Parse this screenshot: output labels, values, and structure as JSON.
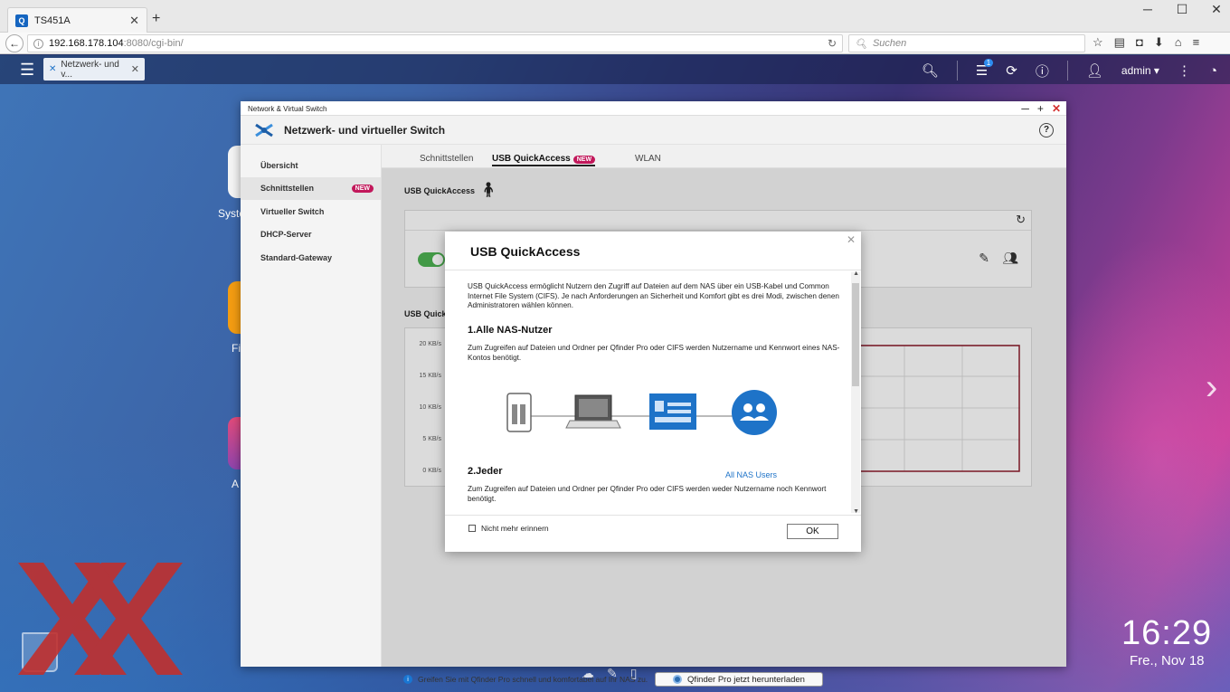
{
  "browser": {
    "tab_title": "TS451A",
    "url_host": "192.168.178.104",
    "url_path": ":8080/cgi-bin/",
    "search_placeholder": "Suchen"
  },
  "qts": {
    "task_title": "Netzwerk- und v...",
    "notification_count": "1",
    "user": "admin ▾",
    "desktop_labels": [
      "Syste",
      "Fi",
      "A"
    ],
    "clock": "16:29",
    "date": "Fre., Nov 18"
  },
  "app": {
    "window_title": "Network & Virtual Switch",
    "header_title": "Netzwerk- und virtueller Switch",
    "sidebar": [
      {
        "label": "Übersicht",
        "badge": ""
      },
      {
        "label": "Schnittstellen",
        "badge": "NEW"
      },
      {
        "label": "Virtueller Switch",
        "badge": ""
      },
      {
        "label": "DHCP-Server",
        "badge": ""
      },
      {
        "label": "Standard-Gateway",
        "badge": ""
      }
    ],
    "tabs": [
      {
        "label": "Schnittstellen",
        "badge": ""
      },
      {
        "label": "USB QuickAccess",
        "badge": "NEW"
      },
      {
        "label": "WLAN",
        "badge": ""
      }
    ],
    "section_title": "USB QuickAccess",
    "section_title_2": "USB Quick",
    "chart_ticks": [
      "20 KB/s",
      "15 KB/s",
      "10 KB/s",
      "5 KB/s",
      "0 KB/s"
    ],
    "footer_text": "Greifen Sie mit Qfinder Pro schnell und komfortabel auf Ihr NAS zu.",
    "footer_button": "Qfinder Pro jetzt herunterladen"
  },
  "modal": {
    "title": "USB QuickAccess",
    "intro": "USB QuickAccess ermöglicht Nutzern den Zugriff auf Dateien auf dem NAS über ein USB-Kabel und Common Internet File System (CIFS). Je nach Anforderungen an Sicherheit und Komfort gibt es drei Modi, zwischen denen Administratoren wählen können.",
    "section1_title": "1.Alle NAS-Nutzer",
    "section1_text": "Zum Zugreifen auf Dateien und Ordner per Qfinder Pro oder CIFS werden Nutzername und Kennwort eines NAS-Kontos benötigt.",
    "diagram_label": "All NAS Users",
    "section2_title": "2.Jeder",
    "section2_text": "Zum Zugreifen auf Dateien und Ordner per Qfinder Pro oder CIFS werden weder Nutzername noch Kennwort benötigt.",
    "checkbox_label": "Nicht mehr erinnern",
    "ok_label": "OK"
  }
}
